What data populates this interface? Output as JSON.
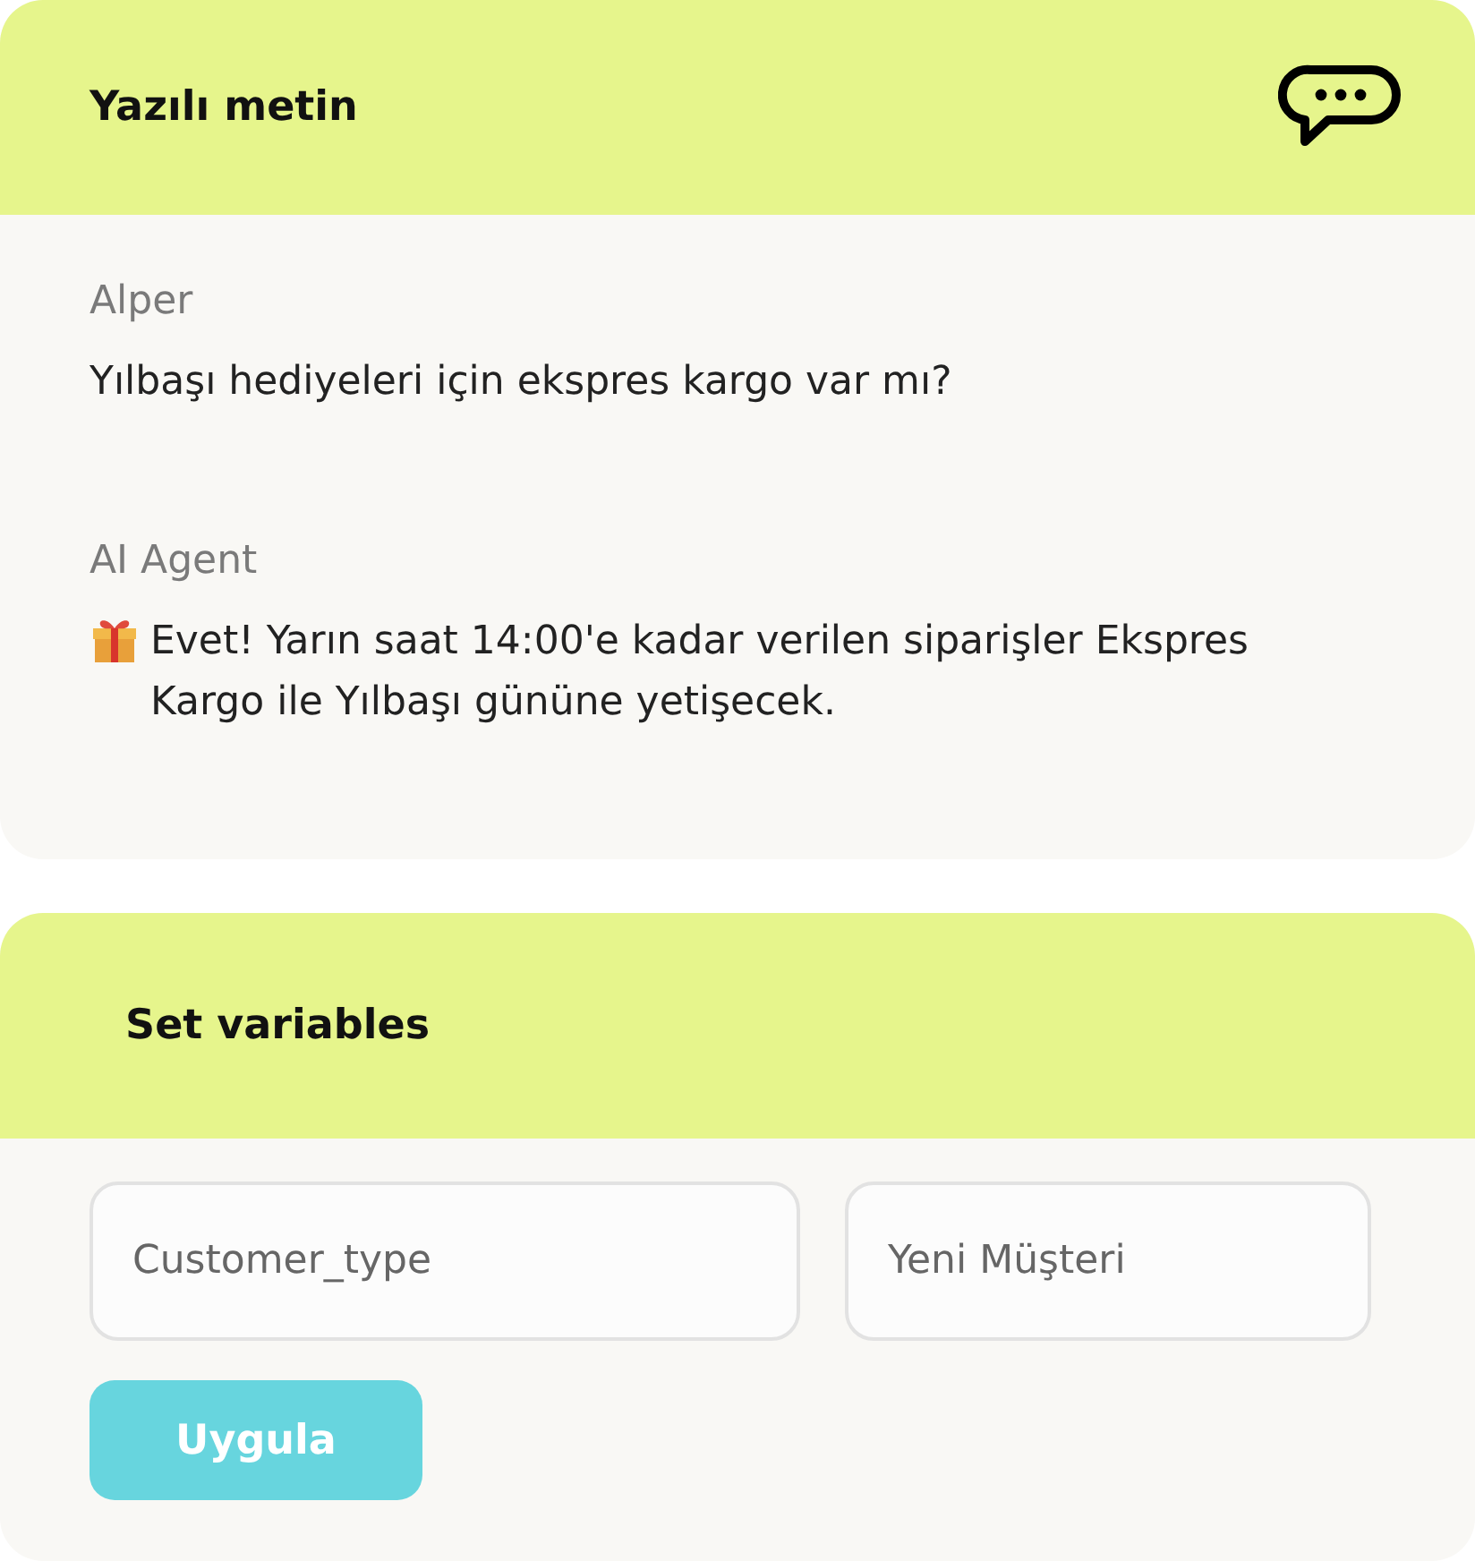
{
  "transcript_card": {
    "title": "Yazılı metin",
    "messages": [
      {
        "sender": "Alper",
        "text": "Yılbaşı hediyeleri için ekspres kargo var mı?",
        "kind": "plain"
      },
      {
        "sender": "AI Agent",
        "text": "Evet! Yarın saat 14:00'e kadar verilen siparişler Ekspres Kargo ile Yılbaşı gününe yetişecek.",
        "kind": "gift"
      }
    ]
  },
  "variables_card": {
    "title": "Set variables",
    "fields": [
      {
        "value": "Customer_type"
      },
      {
        "value": "Yeni Müşteri"
      }
    ],
    "button": "Uygula"
  }
}
